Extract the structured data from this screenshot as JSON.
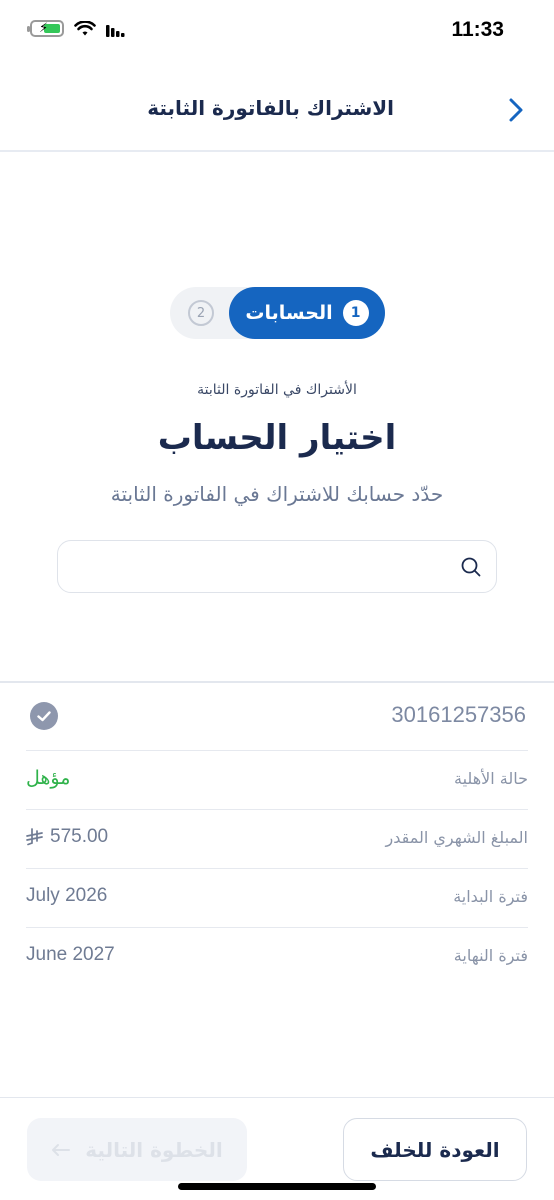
{
  "status_bar": {
    "time": "11:33"
  },
  "header": {
    "title": "الاشتراك بالفاتورة الثابتة"
  },
  "stepper": {
    "active_number": "1",
    "active_label": "الحسابات",
    "inactive_number": "2"
  },
  "content": {
    "subtitle_small": "الأشتراك في الفاتورة الثابتة",
    "title": "اختيار الحساب",
    "description": "حدّد حسابك للاشتراك في الفاتورة الثابتة",
    "search_placeholder": ""
  },
  "account": {
    "number": "30161257356",
    "selected": true,
    "rows": [
      {
        "label": "حالة الأهلية",
        "value": "مؤهل"
      },
      {
        "label": "المبلغ الشهري المقدر",
        "value": "575.00"
      },
      {
        "label": "فترة البداية",
        "value": "July 2026"
      },
      {
        "label": "فترة النهاية",
        "value": "June 2027"
      }
    ]
  },
  "footer": {
    "back_label": "العودة للخلف",
    "next_label": "الخطوة التالية"
  },
  "colors": {
    "primary": "#1565c0",
    "eligible_green": "#2fb24a",
    "title_navy": "#1b2a4e"
  }
}
